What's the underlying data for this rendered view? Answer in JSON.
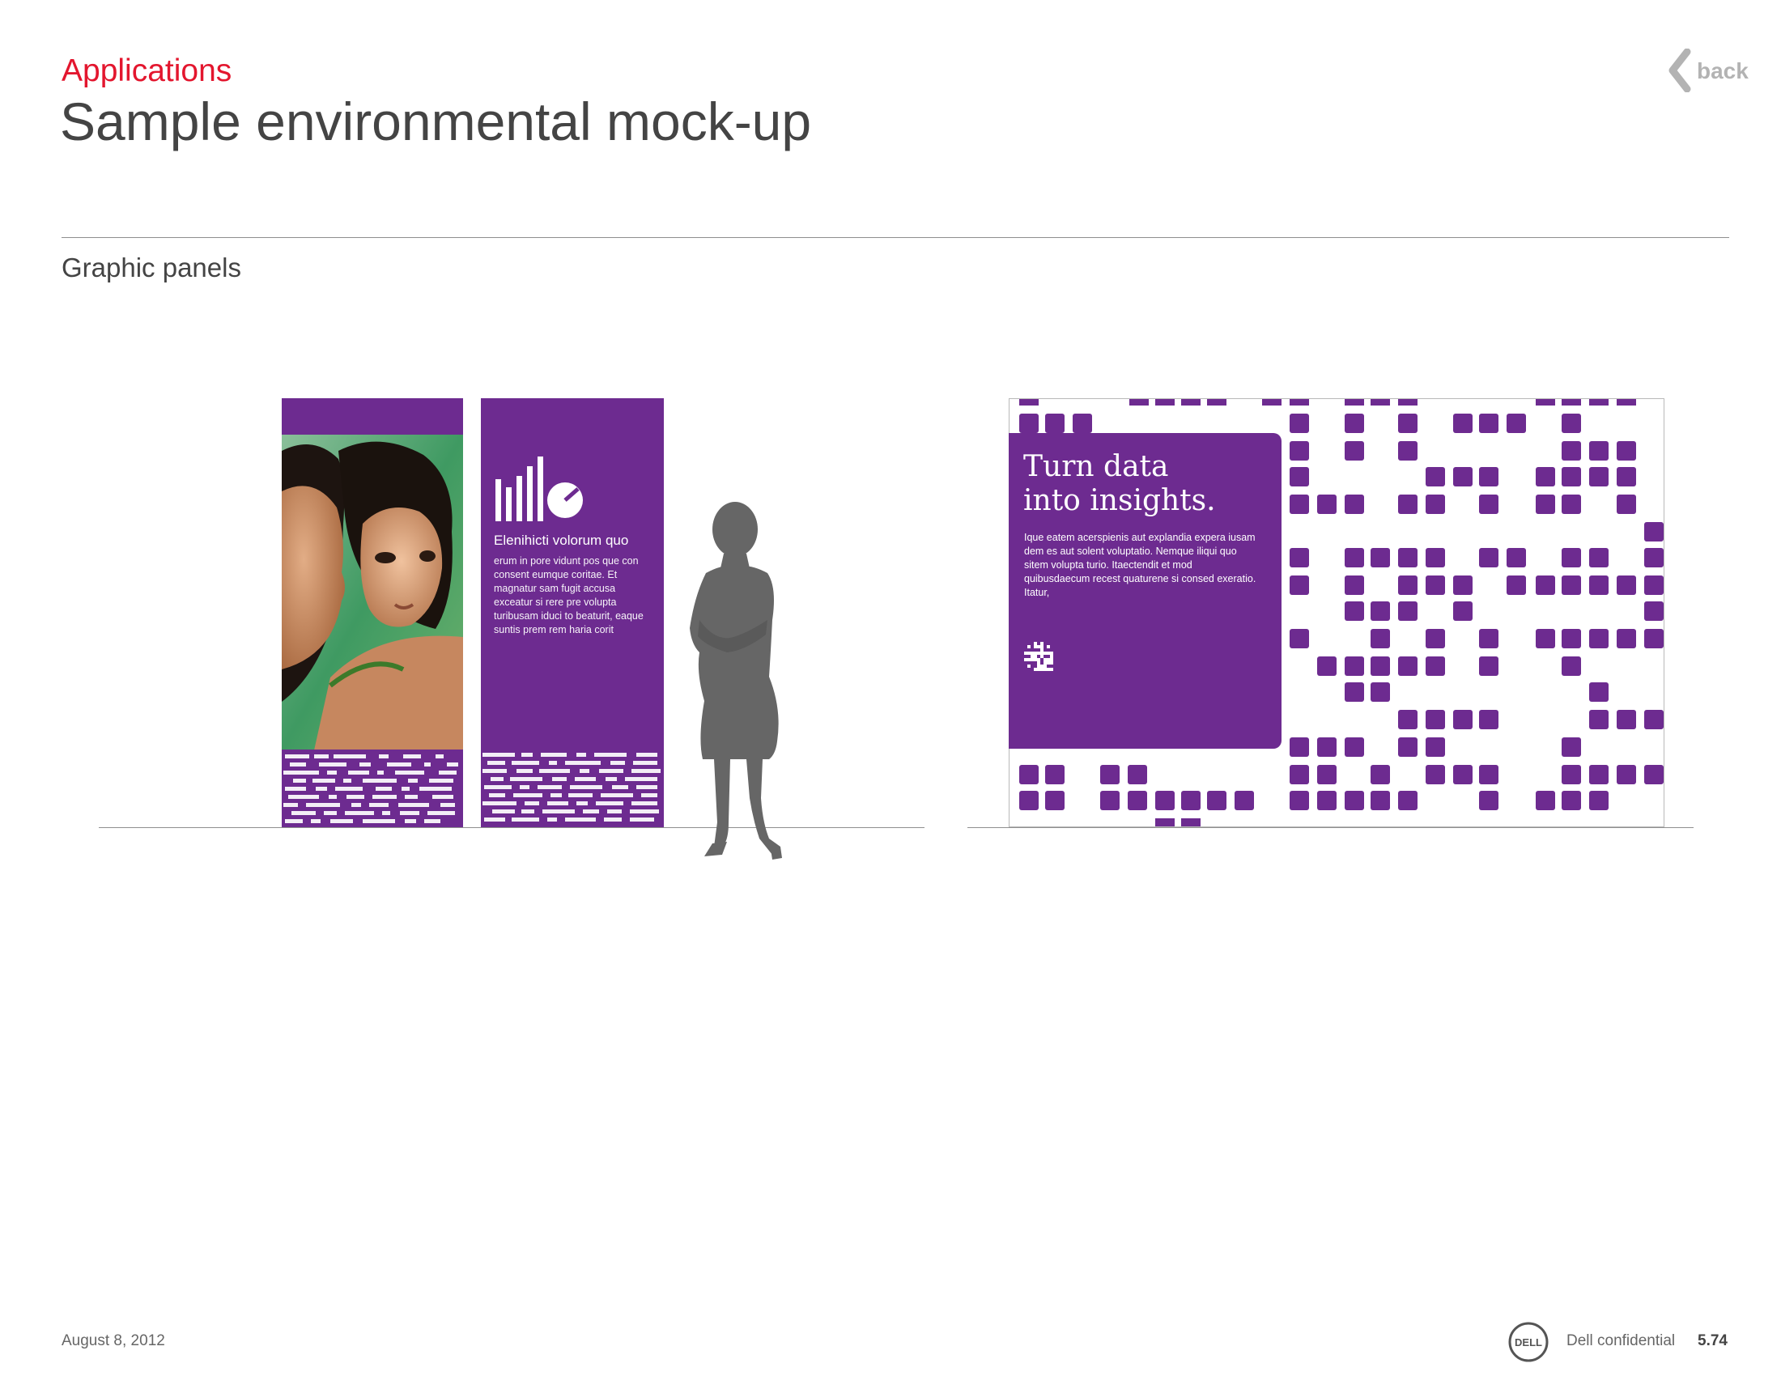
{
  "header": {
    "eyebrow": "Applications",
    "title": "Sample environmental mock-up",
    "back_label": "back"
  },
  "section": {
    "title": "Graphic panels"
  },
  "panel2": {
    "heading": "Elenihicti volorum quo",
    "body": "erum in pore vidunt pos que con consent eumque coritae. Et magnatur sam fugit accusa exceatur si rere pre volupta turibusam iduci to beaturit, eaque suntis prem rem haria corit"
  },
  "wall": {
    "headline_line1": "Turn data",
    "headline_line2": "into insights.",
    "body": "Ique eatem acerspienis aut explandia expera iusam dem es aut solent voluptatio. Nemque iliqui quo sitem volupta turio. Itaectendit et mod quibusdaecum recest quaturene si consed exeratio. Itatur,"
  },
  "footer": {
    "date": "August 8, 2012",
    "confidential": "Dell confidential",
    "page": "5.74",
    "logo_text": "DELL"
  },
  "colors": {
    "brand_purple": "#6d2b90",
    "accent_red": "#e3162e",
    "silhouette_gray": "#666666"
  }
}
